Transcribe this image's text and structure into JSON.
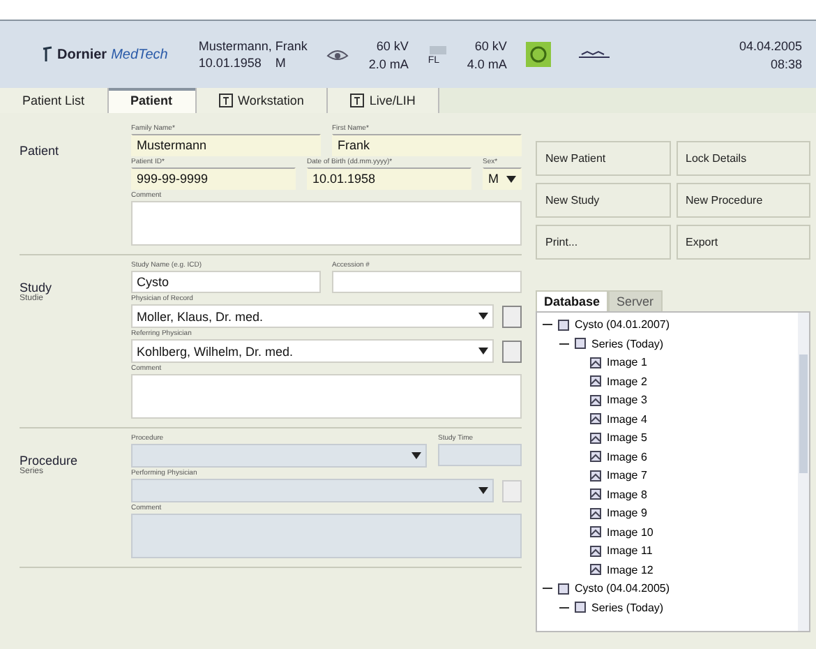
{
  "header": {
    "brand": "Dornier",
    "brand_sub": "MedTech",
    "patient_name": "Mustermann, Frank",
    "patient_dob": "10.01.1958",
    "patient_sex": "M",
    "exposures": [
      {
        "kind": "eye",
        "kv": "60 kV",
        "ma": "2.0 mA"
      },
      {
        "kind": "fluoro",
        "tag": "FL",
        "kv": "60 kV",
        "ma": "4.0 mA"
      }
    ],
    "date": "04.04.2005",
    "time": "08:38"
  },
  "tabs": [
    {
      "label": "Patient List",
      "icon": false,
      "selected": false
    },
    {
      "label": "Patient",
      "icon": false,
      "selected": true
    },
    {
      "label": "Workstation",
      "icon": true,
      "selected": false
    },
    {
      "label": "Live/LIH",
      "icon": true,
      "selected": false
    }
  ],
  "sections": [
    {
      "title": "Patient",
      "rows": [
        [
          {
            "kind": "text",
            "label": "Family Name*",
            "value": "Mustermann",
            "required": true,
            "disabled": false
          },
          {
            "kind": "text",
            "label": "First Name*",
            "value": "Frank",
            "required": true,
            "disabled": false
          }
        ],
        [
          {
            "kind": "text",
            "label": "Patient ID*",
            "value": "999-99-9999",
            "required": true,
            "disabled": false
          },
          {
            "kind": "text",
            "label": "Date of Birth (dd.mm.yyyy)*",
            "value": "10.01.1958",
            "required": true,
            "disabled": false
          },
          {
            "kind": "sex",
            "label": "Sex*",
            "value": "M",
            "required": true,
            "disabled": false
          }
        ],
        [
          {
            "kind": "textarea",
            "label": "Comment",
            "required": false,
            "disabled": false
          }
        ]
      ]
    },
    {
      "title": "Study",
      "subtitle": "Studie",
      "rows": [
        [
          {
            "kind": "text",
            "label": "Study Name (e.g. ICD)",
            "value": "Cysto",
            "required": false,
            "disabled": false
          },
          {
            "kind": "text",
            "label": "Accession #",
            "required": false,
            "disabled": false
          }
        ],
        [
          {
            "kind": "combo",
            "label": "Physician of Record",
            "value": "Moller, Klaus, Dr. med.",
            "required": false,
            "disabled": false
          }
        ],
        [
          {
            "kind": "combo",
            "label": "Referring Physician",
            "value": "Kohlberg, Wilhelm, Dr. med.",
            "required": false,
            "disabled": false
          }
        ],
        [
          {
            "kind": "textarea",
            "label": "Comment",
            "required": false,
            "disabled": false
          }
        ]
      ]
    },
    {
      "title": "Procedure",
      "subtitle": "Series",
      "rows": [
        [
          {
            "kind": "select",
            "label": "Procedure",
            "disabled": true
          },
          {
            "kind": "short",
            "label": "Study Time",
            "disabled": true
          }
        ],
        [
          {
            "kind": "combo",
            "label": "Performing Physician",
            "disabled": true
          }
        ],
        [
          {
            "kind": "textarea",
            "label": "Comment",
            "disabled": true
          }
        ]
      ]
    }
  ],
  "buttons": [
    "New Patient",
    "Lock Details",
    "New Study",
    "New Procedure",
    "Print...",
    "Export"
  ],
  "tree_tabs": [
    {
      "label": "Database",
      "selected": true
    },
    {
      "label": "Server",
      "selected": false
    }
  ],
  "tree": [
    {
      "label": "Cysto (04.01.2007)",
      "expanded": true,
      "children": [
        {
          "label": "Series (Today)",
          "expanded": true,
          "children": [
            {
              "label": "Image 1"
            },
            {
              "label": "Image 2"
            },
            {
              "label": "Image 3"
            },
            {
              "label": "Image 4"
            },
            {
              "label": "Image 5"
            },
            {
              "label": "Image 6"
            },
            {
              "label": "Image 7"
            },
            {
              "label": "Image 8"
            },
            {
              "label": "Image 9"
            },
            {
              "label": "Image 10"
            },
            {
              "label": "Image 11"
            },
            {
              "label": "Image 12"
            }
          ]
        }
      ]
    },
    {
      "label": "Cysto (04.04.2005)",
      "expanded": true,
      "children": [
        {
          "label": "Series (Today)",
          "expanded": true
        }
      ]
    }
  ]
}
